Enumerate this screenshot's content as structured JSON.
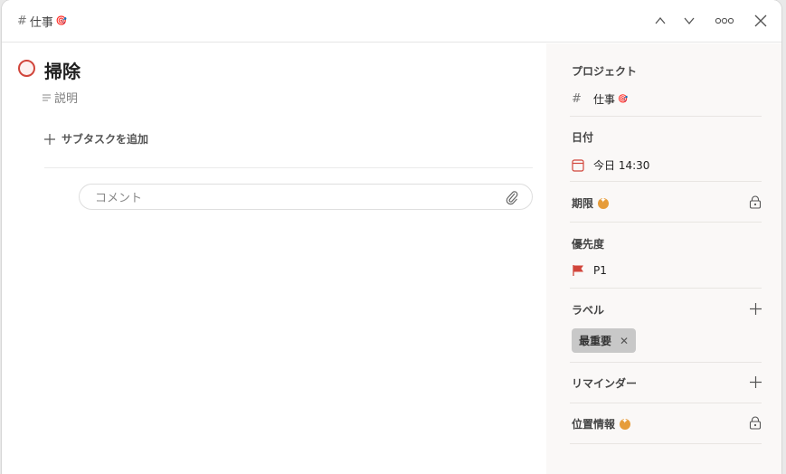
{
  "header": {
    "project_name": "仕事",
    "project_emoji": "🎯",
    "actions": [
      "chevron-up-icon",
      "chevron-down-icon",
      "more-icon",
      "close-icon"
    ]
  },
  "task": {
    "title": "掃除",
    "description_placeholder": "説明",
    "add_subtask_label": "サブタスクを追加",
    "comment_placeholder": "コメント"
  },
  "sidebar": {
    "project": {
      "label": "プロジェクト",
      "value": "仕事",
      "emoji": "🎯"
    },
    "date": {
      "label": "日付",
      "value": "今日 14:30"
    },
    "deadline": {
      "label": "期限"
    },
    "priority": {
      "label": "優先度",
      "value": "P1",
      "flag_color": "#d1453b"
    },
    "labels": {
      "label": "ラベル",
      "chips": [
        "最重要"
      ]
    },
    "reminders": {
      "label": "リマインダー"
    },
    "location": {
      "label": "位置情報"
    }
  },
  "colors": {
    "accent_red": "#d1453b",
    "upgrade_gold": "#e69c3a",
    "sidebar_bg": "#faf8f7"
  }
}
